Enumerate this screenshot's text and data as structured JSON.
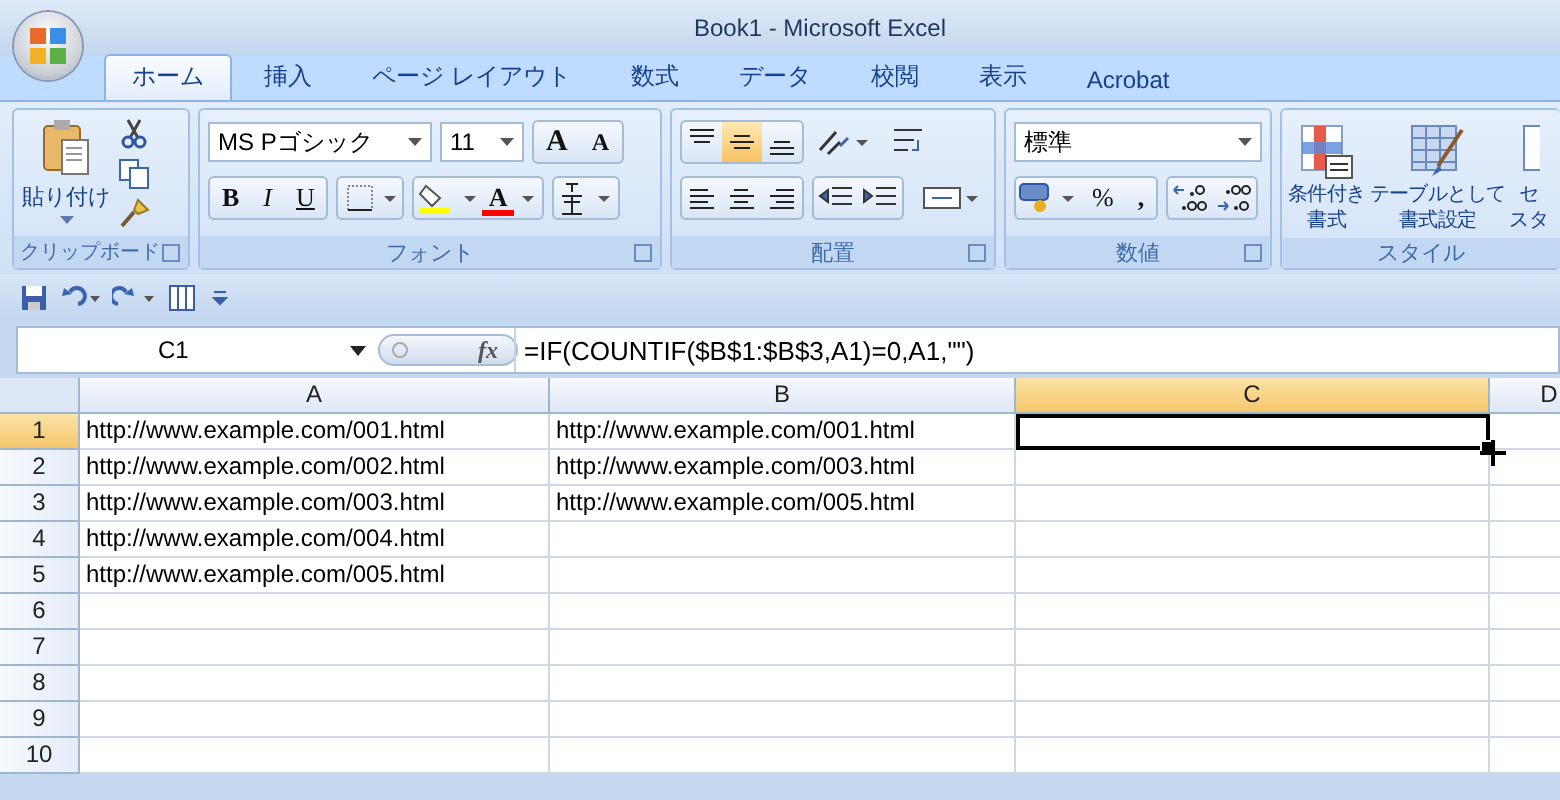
{
  "window": {
    "title": "Book1 - Microsoft Excel"
  },
  "tabs": [
    {
      "label": "ホーム",
      "selected": true
    },
    {
      "label": "挿入",
      "selected": false
    },
    {
      "label": "ページ レイアウト",
      "selected": false
    },
    {
      "label": "数式",
      "selected": false
    },
    {
      "label": "データ",
      "selected": false
    },
    {
      "label": "校閲",
      "selected": false
    },
    {
      "label": "表示",
      "selected": false
    },
    {
      "label": "Acrobat",
      "selected": false
    }
  ],
  "ribbon": {
    "clipboard": {
      "title": "クリップボード",
      "paste_label": "貼り付け"
    },
    "font": {
      "title": "フォント",
      "font_name": "MS Pゴシック",
      "font_size": "11",
      "grow_label": "A",
      "shrink_label": "A",
      "style_buttons": [
        {
          "kind": "bold",
          "label": "B"
        },
        {
          "kind": "italic",
          "label": "I"
        },
        {
          "kind": "underline",
          "label": "U"
        }
      ],
      "color_label": "A"
    },
    "alignment": {
      "title": "配置",
      "vertical_buttons": [
        {
          "kind": "top",
          "selected": false
        },
        {
          "kind": "middle",
          "selected": true
        },
        {
          "kind": "bottom",
          "selected": false
        }
      ],
      "horizontal_buttons": [
        {
          "kind": "left",
          "selected": false
        },
        {
          "kind": "center",
          "selected": false
        },
        {
          "kind": "right",
          "selected": false
        }
      ]
    },
    "number": {
      "title": "数値",
      "format": "標準",
      "percent_label": "%",
      "comma_label": ","
    },
    "styles": {
      "title": "スタイル",
      "buttons": [
        {
          "kind": "conditional",
          "lines": [
            "条件付き",
            "書式"
          ]
        },
        {
          "kind": "table",
          "lines": [
            "テーブルとして",
            "書式設定"
          ]
        },
        {
          "kind": "cell",
          "lines": [
            "セ",
            "スタ"
          ]
        }
      ]
    }
  },
  "formula_bar": {
    "name_box": "C1",
    "fx_label": "fx",
    "formula": "=IF(COUNTIF($B$1:$B$3,A1)=0,A1,\"\")"
  },
  "grid": {
    "columns": [
      {
        "label": "A",
        "selected": false
      },
      {
        "label": "B",
        "selected": false
      },
      {
        "label": "C",
        "selected": true
      },
      {
        "label": "D",
        "selected": false
      }
    ],
    "rows": [
      {
        "label": "1",
        "selected": true,
        "cells": [
          "http://www.example.com/001.html",
          "http://www.example.com/001.html"
        ]
      },
      {
        "label": "2",
        "selected": false,
        "cells": [
          "http://www.example.com/002.html",
          "http://www.example.com/003.html"
        ]
      },
      {
        "label": "3",
        "selected": false,
        "cells": [
          "http://www.example.com/003.html",
          "http://www.example.com/005.html"
        ]
      },
      {
        "label": "4",
        "selected": false,
        "cells": [
          "http://www.example.com/004.html"
        ]
      },
      {
        "label": "5",
        "selected": false,
        "cells": [
          "http://www.example.com/005.html"
        ]
      },
      {
        "label": "6",
        "selected": false,
        "cells": []
      },
      {
        "label": "7",
        "selected": false,
        "cells": []
      },
      {
        "label": "8",
        "selected": false,
        "cells": []
      },
      {
        "label": "9",
        "selected": false,
        "cells": []
      },
      {
        "label": "10",
        "selected": false,
        "cells": []
      }
    ]
  }
}
